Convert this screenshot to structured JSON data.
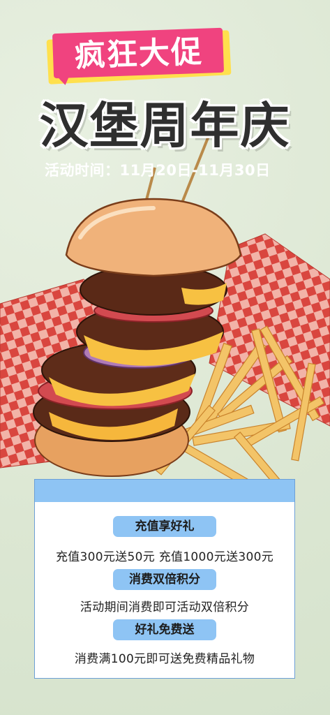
{
  "hero": {
    "tag": "疯狂大促",
    "title": "汉堡周年庆",
    "date": "活动时间：11月20日-11月30日"
  },
  "promotions": [
    {
      "title": "充值享好礼",
      "detail": "充值300元送50元 充值1000元送300元"
    },
    {
      "title": "消费双倍积分",
      "detail": "活动期间消费即可活动双倍积分"
    },
    {
      "title": "好礼免费送",
      "detail": "消费满100元即可送免费精品礼物"
    }
  ],
  "colors": {
    "background": "#dfe9d6",
    "tag_pink": "#f0437f",
    "tag_yellow": "#ffe04d",
    "card_accent": "#8ec4f4",
    "title": "#2f2f2f"
  }
}
